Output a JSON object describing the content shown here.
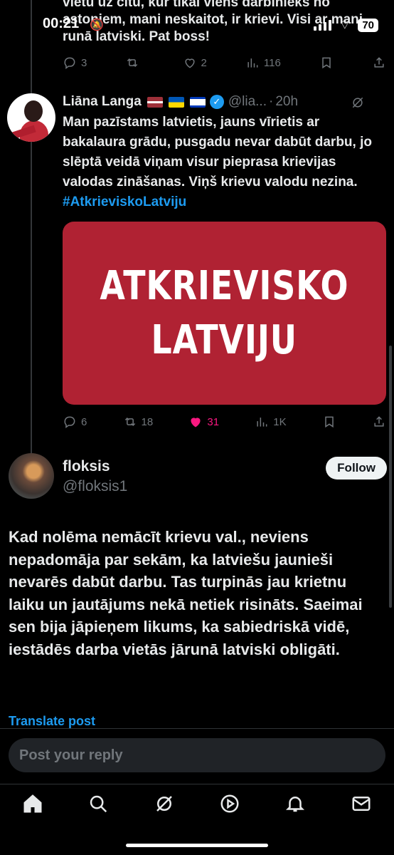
{
  "status_bar": {
    "time": "00:21",
    "battery": "70"
  },
  "prev_tweet": {
    "text_tail": "vietu uz citu, kur tikai viens darbinieks no astoņiem, mani neskaitot, ir krievi. Visi ar mani runā latviski. Pat boss!",
    "replies": "3",
    "reposts": "",
    "likes": "2",
    "views": "116"
  },
  "quoted_tweet": {
    "name": "Liāna Langa",
    "handle": "@lia...",
    "time": "20h",
    "text": "Man pazīstams latvietis, jauns vīrietis ar bakalaura grādu, pusgadu nevar dabūt darbu, jo slēptā veidā viņam visur pieprasa krievijas valodas zināšanas. Viņš krievu valodu nezina. ",
    "hashtag": "#AtkrieviskoLatviju",
    "media_line1": "ATKRIEVISKO",
    "media_line2": "LATVIJU",
    "replies": "6",
    "reposts": "18",
    "likes": "31",
    "views": "1K"
  },
  "main_tweet": {
    "name": "floksis",
    "handle": "@floksis1",
    "follow_label": "Follow",
    "text": "Kad nolēma nemācīt krievu val., neviens nepadomāja par sekām, ka latviešu jaunieši nevarēs dabūt darbu. Tas turpinās jau krietnu laiku un jautājums nekā netiek risināts. Saeimai sen bija jāpieņem likums, ka sabiedriskā vidē, iestādēs  darba vietās jārunā latviski obligāti.",
    "translate_label": "Translate post"
  },
  "reply": {
    "placeholder": "Post your reply"
  },
  "nav": [
    "home-icon",
    "search-icon",
    "grok-icon",
    "video-icon",
    "notifications-icon",
    "messages-icon"
  ],
  "colors": {
    "accent": "#1d9bf0",
    "like": "#f91880",
    "media_bg": "#b02233"
  }
}
